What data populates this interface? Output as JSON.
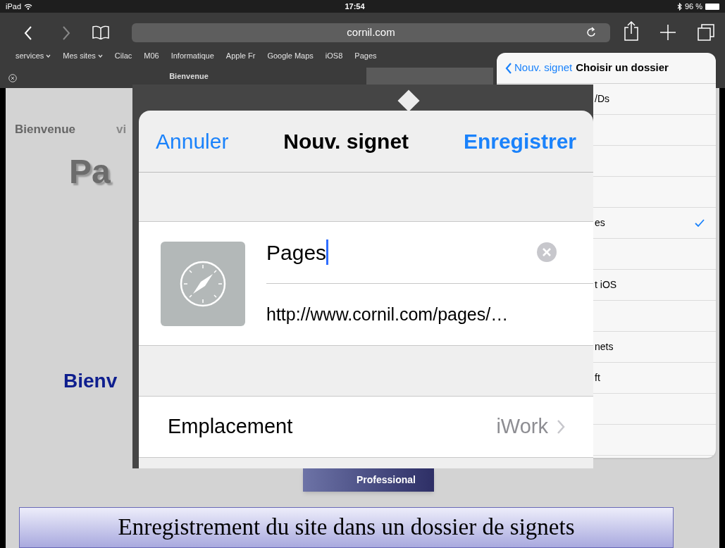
{
  "status_bar": {
    "device": "iPad",
    "time": "17:54",
    "battery": "96 %"
  },
  "toolbar": {
    "url": "cornil.com"
  },
  "bookmarks_bar": [
    {
      "label": "services",
      "menu": true
    },
    {
      "label": "Mes sites",
      "menu": true
    },
    {
      "label": "Cilac",
      "menu": false
    },
    {
      "label": "M06",
      "menu": false
    },
    {
      "label": "Informatique",
      "menu": false
    },
    {
      "label": "Apple Fr",
      "menu": false
    },
    {
      "label": "Google Maps",
      "menu": false
    },
    {
      "label": "iOS8",
      "menu": false
    },
    {
      "label": "Pages",
      "menu": false
    }
  ],
  "tabs": [
    {
      "title": "Bienvenue",
      "selected": true
    },
    {
      "selected": false
    }
  ],
  "web_page": {
    "nav_link": "Bienvenue",
    "nav_link_2": "vi",
    "logo_text": "Pa",
    "heading": "Bienv",
    "badge_text": "Professional"
  },
  "bookmark_sheet": {
    "cancel": "Annuler",
    "title": "Nouv. signet",
    "save": "Enregistrer",
    "name_value": "Pages",
    "url": "http://www.cornil.com/pages/…",
    "location_label": "Emplacement",
    "location_value": "iWork"
  },
  "folder_popover": {
    "back": "Nouv. signet",
    "title": "Choisir un dossier",
    "rows": [
      {
        "label": "/Ds",
        "selected": false
      },
      {
        "selected": false
      },
      {
        "selected": false
      },
      {
        "selected": false
      },
      {
        "label": "es",
        "selected": true
      },
      {
        "selected": false
      },
      {
        "label": "t iOS",
        "selected": false
      },
      {
        "selected": false
      },
      {
        "label": "nets",
        "selected": false
      },
      {
        "label": "ft",
        "selected": false
      },
      {
        "selected": false
      },
      {
        "selected": false
      }
    ]
  },
  "caption": "Enregistrement du site dans un dossier de signets"
}
